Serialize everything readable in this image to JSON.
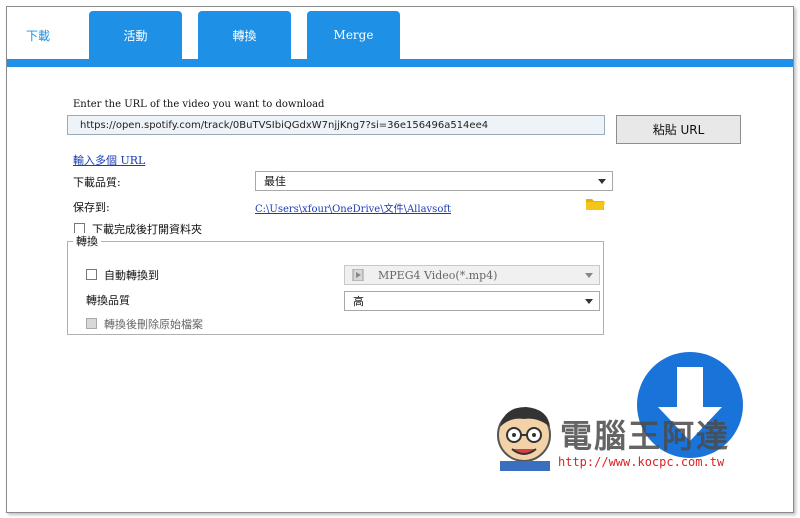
{
  "tabs": [
    {
      "label": "下載",
      "active": true
    },
    {
      "label": "活動",
      "active": false
    },
    {
      "label": "轉換",
      "active": false
    },
    {
      "label": "Merge",
      "active": false
    }
  ],
  "url_prompt": "Enter the URL of the video you want to download",
  "url_value": "https://open.spotify.com/track/0BuTVSIbiQGdxW7njjKng7?si=36e156496a514ee4",
  "paste_button": "粘貼 URL",
  "multi_url_link": "輸入多個 URL",
  "quality_label": "下載品質:",
  "quality_value": "最佳",
  "save_label": "保存到:",
  "save_path": "C:\\Users\\xfour\\OneDrive\\文件\\Allavsoft",
  "open_folder_label": "下載完成後打開資料夾",
  "convert_group_title": "轉換",
  "auto_convert_label": "自動轉換到",
  "auto_convert_value": "MPEG4 Video(*.mp4)",
  "convert_quality_label": "轉換品質",
  "convert_quality_value": "高",
  "delete_original_label": "轉換後刪除原始檔案",
  "watermark": {
    "title": "電腦王阿達",
    "url": "http://www.kocpc.com.tw"
  },
  "colors": {
    "accent": "#1e90e6",
    "link": "#1a3db3",
    "folder": "#f5c518"
  }
}
